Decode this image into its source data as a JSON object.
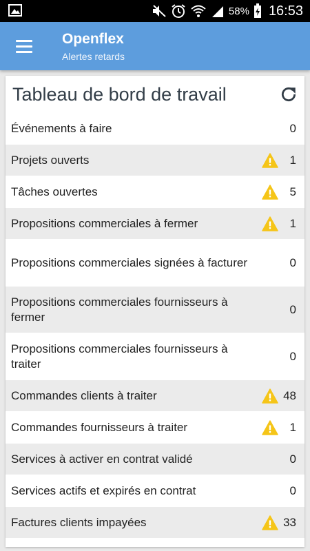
{
  "status_bar": {
    "battery_percent": "58%",
    "time": "16:53",
    "icons": [
      "image-icon",
      "mute-icon",
      "alarm-icon",
      "wifi-icon",
      "signal-icon",
      "battery-charging-icon"
    ]
  },
  "app_bar": {
    "title": "Openflex",
    "subtitle": "Alertes retards",
    "menu_icon": "hamburger-menu-icon",
    "color": "#5d9ddd"
  },
  "dashboard": {
    "title": "Tableau de bord de travail",
    "refresh_icon": "refresh-icon",
    "warning_color": "#f5c518",
    "items": [
      {
        "label": "Événements à faire",
        "count": "0",
        "warning": false
      },
      {
        "label": "Projets ouverts",
        "count": "1",
        "warning": true
      },
      {
        "label": "Tâches ouvertes",
        "count": "5",
        "warning": true
      },
      {
        "label": "Propositions commerciales à fermer",
        "count": "1",
        "warning": true
      },
      {
        "label": "Propositions commerciales signées à facturer",
        "count": "0",
        "warning": false
      },
      {
        "label": "Propositions commerciales fournisseurs à fermer",
        "count": "0",
        "warning": false
      },
      {
        "label": "Propositions commerciales fournisseurs à traiter",
        "count": "0",
        "warning": false
      },
      {
        "label": "Commandes clients à traiter",
        "count": "48",
        "warning": true
      },
      {
        "label": "Commandes fournisseurs à traiter",
        "count": "1",
        "warning": true
      },
      {
        "label": "Services à activer en contrat validé",
        "count": "0",
        "warning": false
      },
      {
        "label": "Services actifs et expirés en contrat",
        "count": "0",
        "warning": false
      },
      {
        "label": "Factures clients impayées",
        "count": "33",
        "warning": true
      }
    ]
  }
}
